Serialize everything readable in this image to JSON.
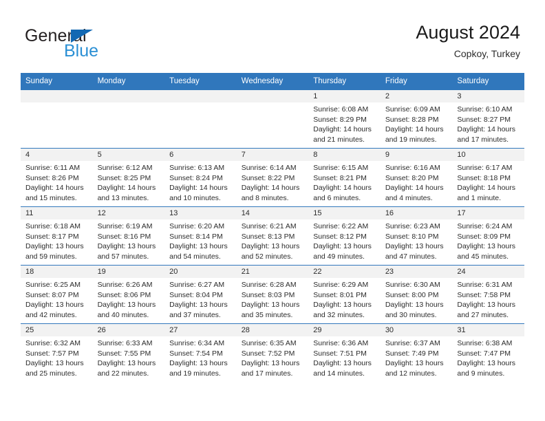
{
  "logo": {
    "word_top": "General",
    "word_bottom": "Blue",
    "triangle_color": "#1268b3",
    "blue_color": "#2a8fd4"
  },
  "header": {
    "title": "August 2024",
    "subtitle": "Copkoy, Turkey"
  },
  "theme": {
    "header_bar": "#3077bc",
    "daynum_strip": "#f2f2f2",
    "text": "#2b2b2b"
  },
  "labels": {
    "sunrise_prefix": "Sunrise:",
    "sunset_prefix": "Sunset:",
    "daylight_prefix": "Daylight:"
  },
  "weekdays": [
    "Sunday",
    "Monday",
    "Tuesday",
    "Wednesday",
    "Thursday",
    "Friday",
    "Saturday"
  ],
  "weeks": [
    [
      {
        "day": "",
        "empty": true
      },
      {
        "day": "",
        "empty": true
      },
      {
        "day": "",
        "empty": true
      },
      {
        "day": "",
        "empty": true
      },
      {
        "day": "1",
        "sunrise": "Sunrise: 6:08 AM",
        "sunset": "Sunset: 8:29 PM",
        "daylight_1": "Daylight: 14 hours",
        "daylight_2": "and 21 minutes."
      },
      {
        "day": "2",
        "sunrise": "Sunrise: 6:09 AM",
        "sunset": "Sunset: 8:28 PM",
        "daylight_1": "Daylight: 14 hours",
        "daylight_2": "and 19 minutes."
      },
      {
        "day": "3",
        "sunrise": "Sunrise: 6:10 AM",
        "sunset": "Sunset: 8:27 PM",
        "daylight_1": "Daylight: 14 hours",
        "daylight_2": "and 17 minutes."
      }
    ],
    [
      {
        "day": "4",
        "sunrise": "Sunrise: 6:11 AM",
        "sunset": "Sunset: 8:26 PM",
        "daylight_1": "Daylight: 14 hours",
        "daylight_2": "and 15 minutes."
      },
      {
        "day": "5",
        "sunrise": "Sunrise: 6:12 AM",
        "sunset": "Sunset: 8:25 PM",
        "daylight_1": "Daylight: 14 hours",
        "daylight_2": "and 13 minutes."
      },
      {
        "day": "6",
        "sunrise": "Sunrise: 6:13 AM",
        "sunset": "Sunset: 8:24 PM",
        "daylight_1": "Daylight: 14 hours",
        "daylight_2": "and 10 minutes."
      },
      {
        "day": "7",
        "sunrise": "Sunrise: 6:14 AM",
        "sunset": "Sunset: 8:22 PM",
        "daylight_1": "Daylight: 14 hours",
        "daylight_2": "and 8 minutes."
      },
      {
        "day": "8",
        "sunrise": "Sunrise: 6:15 AM",
        "sunset": "Sunset: 8:21 PM",
        "daylight_1": "Daylight: 14 hours",
        "daylight_2": "and 6 minutes."
      },
      {
        "day": "9",
        "sunrise": "Sunrise: 6:16 AM",
        "sunset": "Sunset: 8:20 PM",
        "daylight_1": "Daylight: 14 hours",
        "daylight_2": "and 4 minutes."
      },
      {
        "day": "10",
        "sunrise": "Sunrise: 6:17 AM",
        "sunset": "Sunset: 8:18 PM",
        "daylight_1": "Daylight: 14 hours",
        "daylight_2": "and 1 minute."
      }
    ],
    [
      {
        "day": "11",
        "sunrise": "Sunrise: 6:18 AM",
        "sunset": "Sunset: 8:17 PM",
        "daylight_1": "Daylight: 13 hours",
        "daylight_2": "and 59 minutes."
      },
      {
        "day": "12",
        "sunrise": "Sunrise: 6:19 AM",
        "sunset": "Sunset: 8:16 PM",
        "daylight_1": "Daylight: 13 hours",
        "daylight_2": "and 57 minutes."
      },
      {
        "day": "13",
        "sunrise": "Sunrise: 6:20 AM",
        "sunset": "Sunset: 8:14 PM",
        "daylight_1": "Daylight: 13 hours",
        "daylight_2": "and 54 minutes."
      },
      {
        "day": "14",
        "sunrise": "Sunrise: 6:21 AM",
        "sunset": "Sunset: 8:13 PM",
        "daylight_1": "Daylight: 13 hours",
        "daylight_2": "and 52 minutes."
      },
      {
        "day": "15",
        "sunrise": "Sunrise: 6:22 AM",
        "sunset": "Sunset: 8:12 PM",
        "daylight_1": "Daylight: 13 hours",
        "daylight_2": "and 49 minutes."
      },
      {
        "day": "16",
        "sunrise": "Sunrise: 6:23 AM",
        "sunset": "Sunset: 8:10 PM",
        "daylight_1": "Daylight: 13 hours",
        "daylight_2": "and 47 minutes."
      },
      {
        "day": "17",
        "sunrise": "Sunrise: 6:24 AM",
        "sunset": "Sunset: 8:09 PM",
        "daylight_1": "Daylight: 13 hours",
        "daylight_2": "and 45 minutes."
      }
    ],
    [
      {
        "day": "18",
        "sunrise": "Sunrise: 6:25 AM",
        "sunset": "Sunset: 8:07 PM",
        "daylight_1": "Daylight: 13 hours",
        "daylight_2": "and 42 minutes."
      },
      {
        "day": "19",
        "sunrise": "Sunrise: 6:26 AM",
        "sunset": "Sunset: 8:06 PM",
        "daylight_1": "Daylight: 13 hours",
        "daylight_2": "and 40 minutes."
      },
      {
        "day": "20",
        "sunrise": "Sunrise: 6:27 AM",
        "sunset": "Sunset: 8:04 PM",
        "daylight_1": "Daylight: 13 hours",
        "daylight_2": "and 37 minutes."
      },
      {
        "day": "21",
        "sunrise": "Sunrise: 6:28 AM",
        "sunset": "Sunset: 8:03 PM",
        "daylight_1": "Daylight: 13 hours",
        "daylight_2": "and 35 minutes."
      },
      {
        "day": "22",
        "sunrise": "Sunrise: 6:29 AM",
        "sunset": "Sunset: 8:01 PM",
        "daylight_1": "Daylight: 13 hours",
        "daylight_2": "and 32 minutes."
      },
      {
        "day": "23",
        "sunrise": "Sunrise: 6:30 AM",
        "sunset": "Sunset: 8:00 PM",
        "daylight_1": "Daylight: 13 hours",
        "daylight_2": "and 30 minutes."
      },
      {
        "day": "24",
        "sunrise": "Sunrise: 6:31 AM",
        "sunset": "Sunset: 7:58 PM",
        "daylight_1": "Daylight: 13 hours",
        "daylight_2": "and 27 minutes."
      }
    ],
    [
      {
        "day": "25",
        "sunrise": "Sunrise: 6:32 AM",
        "sunset": "Sunset: 7:57 PM",
        "daylight_1": "Daylight: 13 hours",
        "daylight_2": "and 25 minutes."
      },
      {
        "day": "26",
        "sunrise": "Sunrise: 6:33 AM",
        "sunset": "Sunset: 7:55 PM",
        "daylight_1": "Daylight: 13 hours",
        "daylight_2": "and 22 minutes."
      },
      {
        "day": "27",
        "sunrise": "Sunrise: 6:34 AM",
        "sunset": "Sunset: 7:54 PM",
        "daylight_1": "Daylight: 13 hours",
        "daylight_2": "and 19 minutes."
      },
      {
        "day": "28",
        "sunrise": "Sunrise: 6:35 AM",
        "sunset": "Sunset: 7:52 PM",
        "daylight_1": "Daylight: 13 hours",
        "daylight_2": "and 17 minutes."
      },
      {
        "day": "29",
        "sunrise": "Sunrise: 6:36 AM",
        "sunset": "Sunset: 7:51 PM",
        "daylight_1": "Daylight: 13 hours",
        "daylight_2": "and 14 minutes."
      },
      {
        "day": "30",
        "sunrise": "Sunrise: 6:37 AM",
        "sunset": "Sunset: 7:49 PM",
        "daylight_1": "Daylight: 13 hours",
        "daylight_2": "and 12 minutes."
      },
      {
        "day": "31",
        "sunrise": "Sunrise: 6:38 AM",
        "sunset": "Sunset: 7:47 PM",
        "daylight_1": "Daylight: 13 hours",
        "daylight_2": "and 9 minutes."
      }
    ]
  ]
}
